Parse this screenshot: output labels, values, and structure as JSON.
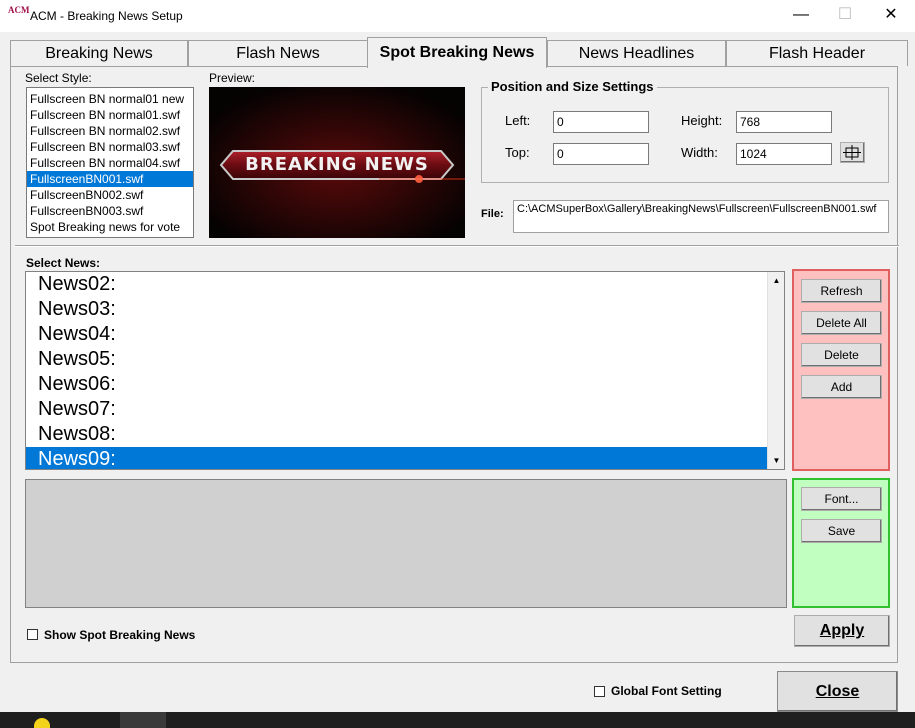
{
  "window": {
    "title": "ACM - Breaking News Setup",
    "icon_text": "ACM",
    "minimize": "—",
    "maximize": "☐",
    "close": "✕"
  },
  "tabs": [
    {
      "label": "Breaking News"
    },
    {
      "label": "Flash News"
    },
    {
      "label": "Spot Breaking News"
    },
    {
      "label": "News Headlines"
    },
    {
      "label": "Flash Header"
    }
  ],
  "style_section": {
    "label": "Select Style:",
    "items": [
      "Fullscreen BN normal01 new",
      "Fullscreen BN normal01.swf",
      "Fullscreen BN normal02.swf",
      "Fullscreen BN normal03.swf",
      "Fullscreen BN normal04.swf",
      "FullscreenBN001.swf",
      "FullscreenBN002.swf",
      "FullscreenBN003.swf",
      "Spot Breaking news for vote"
    ],
    "selected_index": 5
  },
  "preview": {
    "label": "Preview:",
    "banner_text": "BREAKING NEWS"
  },
  "position": {
    "title": "Position and Size Settings",
    "left_label": "Left:",
    "left_value": "0",
    "top_label": "Top:",
    "top_value": "0",
    "height_label": "Height:",
    "height_value": "768",
    "width_label": "Width:",
    "width_value": "1024",
    "fit_icon": "crosshair-icon"
  },
  "file": {
    "label": "File:",
    "value": "C:\\ACMSuperBox\\Gallery\\BreakingNews\\Fullscreen\\FullscreenBN001.swf"
  },
  "news_section": {
    "label": "Select News:",
    "items": [
      "News02:",
      "News03:",
      "News04:",
      "News05:",
      "News06:",
      "News07:",
      "News08:",
      "News09:"
    ],
    "selected_index": 7
  },
  "action_buttons": {
    "refresh": "Refresh",
    "delete_all": "Delete All",
    "delete": "Delete",
    "add": "Add"
  },
  "font_buttons": {
    "font": "Font...",
    "save": "Save"
  },
  "show_spot": {
    "label": "Show Spot Breaking News",
    "checked": false
  },
  "apply_label": "Apply",
  "global_font": {
    "label": "Global Font Setting",
    "checked": false
  },
  "close_label": "Close",
  "colors": {
    "selection": "#0078d7",
    "red_panel": "#ffc0c0",
    "red_border": "#e06060",
    "green_panel": "#c0ffc0",
    "green_border": "#30c030"
  }
}
